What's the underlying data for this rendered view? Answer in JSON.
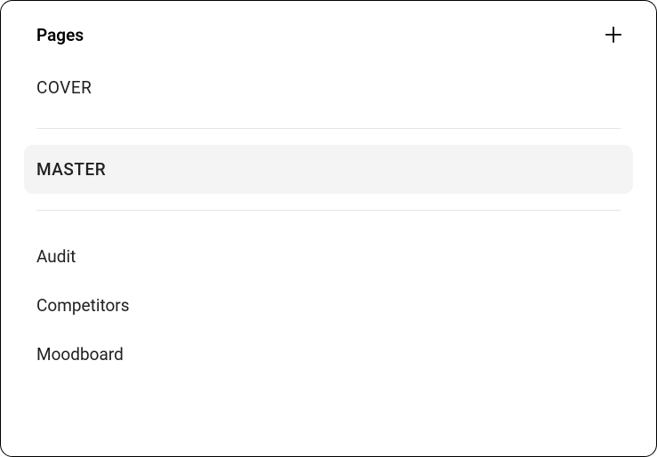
{
  "header": {
    "title": "Pages"
  },
  "pages": {
    "cover": "COVER",
    "master": "MASTER",
    "items": [
      {
        "label": "Audit"
      },
      {
        "label": "Competitors"
      },
      {
        "label": "Moodboard"
      }
    ]
  }
}
